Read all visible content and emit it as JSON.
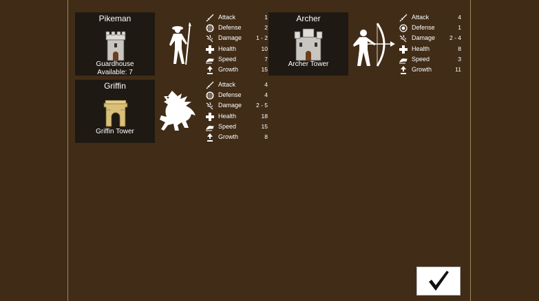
{
  "units": [
    {
      "name": "Pikeman",
      "building": "Guardhouse",
      "available": "Available: 7",
      "stats": [
        {
          "label": "Attack",
          "value": "1",
          "icon": "sword-icon"
        },
        {
          "label": "Defense",
          "value": "2",
          "icon": "shield-icon"
        },
        {
          "label": "Damage",
          "value": "1 - 2",
          "icon": "damage-icon"
        },
        {
          "label": "Health",
          "value": "10",
          "icon": "health-cross-icon"
        },
        {
          "label": "Speed",
          "value": "7",
          "icon": "speed-icon"
        },
        {
          "label": "Growth",
          "value": "15",
          "icon": "growth-icon"
        }
      ]
    },
    {
      "name": "Archer",
      "building": "Archer Tower",
      "stats": [
        {
          "label": "Attack",
          "value": "4",
          "icon": "sword-icon"
        },
        {
          "label": "Defense",
          "value": "1",
          "icon": "shield-icon"
        },
        {
          "label": "Damage",
          "value": "2 - 4",
          "icon": "damage-icon"
        },
        {
          "label": "Health",
          "value": "8",
          "icon": "health-cross-icon"
        },
        {
          "label": "Speed",
          "value": "3",
          "icon": "speed-icon"
        },
        {
          "label": "Growth",
          "value": "11",
          "icon": "growth-icon"
        }
      ]
    },
    {
      "name": "Griffin",
      "building": "Griffin Tower",
      "stats": [
        {
          "label": "Attack",
          "value": "4",
          "icon": "sword-icon"
        },
        {
          "label": "Defense",
          "value": "4",
          "icon": "shield-icon"
        },
        {
          "label": "Damage",
          "value": "2 - 5",
          "icon": "damage-icon"
        },
        {
          "label": "Health",
          "value": "18",
          "icon": "health-cross-icon"
        },
        {
          "label": "Speed",
          "value": "15",
          "icon": "speed-icon"
        },
        {
          "label": "Growth",
          "value": "8",
          "icon": "growth-icon"
        }
      ]
    }
  ],
  "confirm": {
    "icon": "checkmark-icon"
  }
}
